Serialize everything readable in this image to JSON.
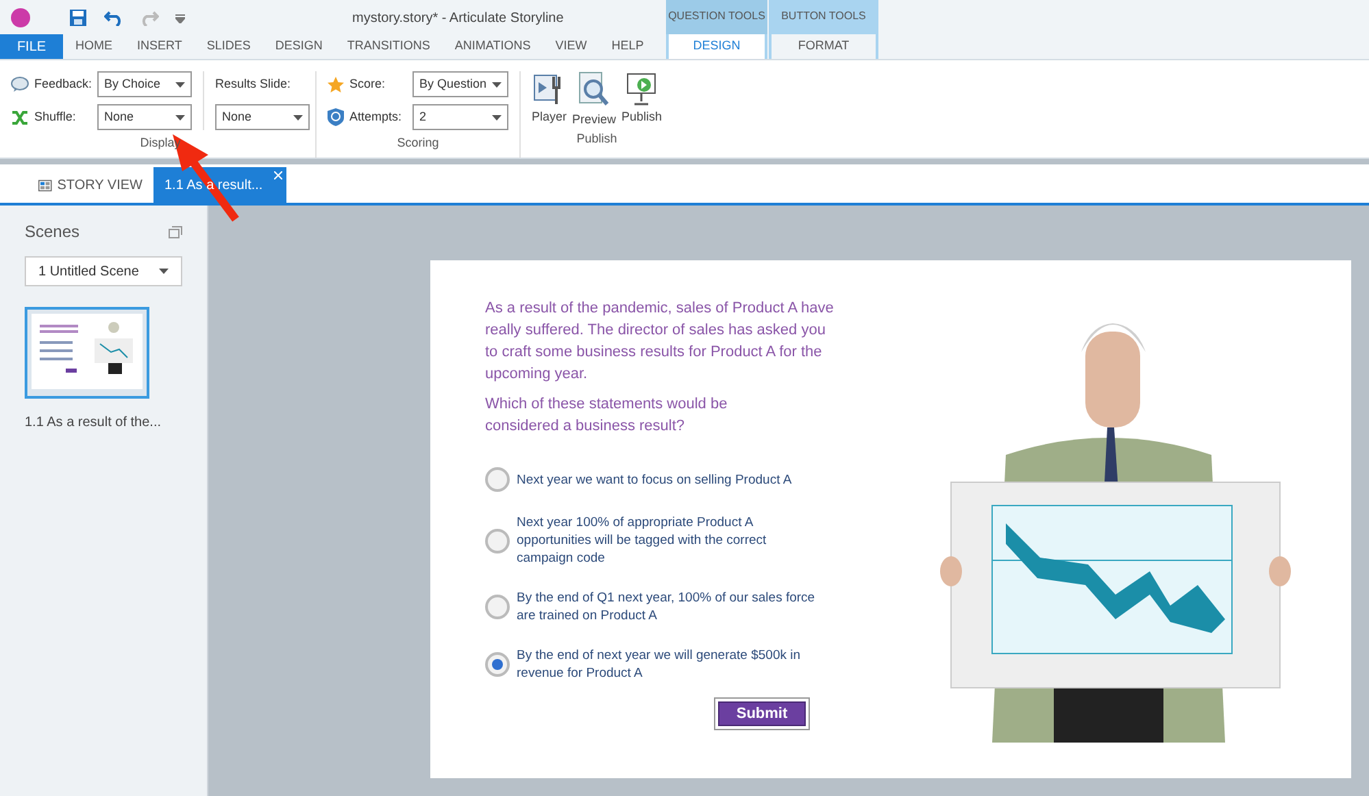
{
  "window": {
    "title": "mystory.story* - Articulate Storyline"
  },
  "menu_tabs": [
    {
      "label": "FILE",
      "kind": "file"
    },
    {
      "label": "HOME",
      "kind": "tab"
    },
    {
      "label": "INSERT",
      "kind": "tab"
    },
    {
      "label": "SLIDES",
      "kind": "tab"
    },
    {
      "label": "DESIGN",
      "kind": "tab"
    },
    {
      "label": "TRANSITIONS",
      "kind": "tab"
    },
    {
      "label": "ANIMATIONS",
      "kind": "tab"
    },
    {
      "label": "VIEW",
      "kind": "tab"
    },
    {
      "label": "HELP",
      "kind": "tab"
    }
  ],
  "contextual_tabs": [
    {
      "group": "QUESTION TOOLS",
      "tab": "DESIGN",
      "selected": true
    },
    {
      "group": "BUTTON TOOLS",
      "tab": "FORMAT",
      "selected": false
    }
  ],
  "ribbon": {
    "display": {
      "feedback": {
        "label": "Feedback:",
        "value": "By Choice"
      },
      "shuffle": {
        "label": "Shuffle:",
        "value": "None"
      },
      "results_slide": {
        "label": "Results Slide:",
        "value": "None"
      },
      "group_label": "Display"
    },
    "scoring": {
      "score": {
        "label": "Score:",
        "value": "By Question"
      },
      "attempts": {
        "label": "Attempts:",
        "value": "2"
      },
      "group_label": "Scoring"
    },
    "publish": {
      "buttons": [
        {
          "label": "Player",
          "kind": "player"
        },
        {
          "label": "Preview",
          "kind": "preview"
        },
        {
          "label": "Publish",
          "kind": "publish"
        }
      ],
      "group_label": "Publish"
    }
  },
  "doc_tabs": [
    {
      "label": "STORY VIEW",
      "kind": "story",
      "selected": false
    },
    {
      "label": "1.1 As a result...",
      "kind": "slide",
      "selected": true
    }
  ],
  "scenes_panel": {
    "title": "Scenes",
    "scene_dropdown": "1 Untitled Scene",
    "thumbnails": [
      {
        "caption": "1.1 As a result of the...",
        "selected": true
      }
    ]
  },
  "slide": {
    "intro": "As a result of the pandemic, sales of Product A have really suffered. The director of sales has asked you to craft some business results for Product A for the upcoming year.",
    "question": "Which of these statements would be considered a business result?",
    "choices": [
      {
        "text": "Next year we want to focus on selling Product A",
        "selected": false
      },
      {
        "text": "Next year 100% of appropriate Product A opportunities will be tagged with the correct campaign code",
        "selected": false
      },
      {
        "text": "By the end of Q1 next year, 100% of our sales force are trained on Product A",
        "selected": false
      },
      {
        "text": "By the end of next year we will generate $500k in revenue for Product A",
        "selected": true
      }
    ],
    "submit_button": "Submit"
  }
}
